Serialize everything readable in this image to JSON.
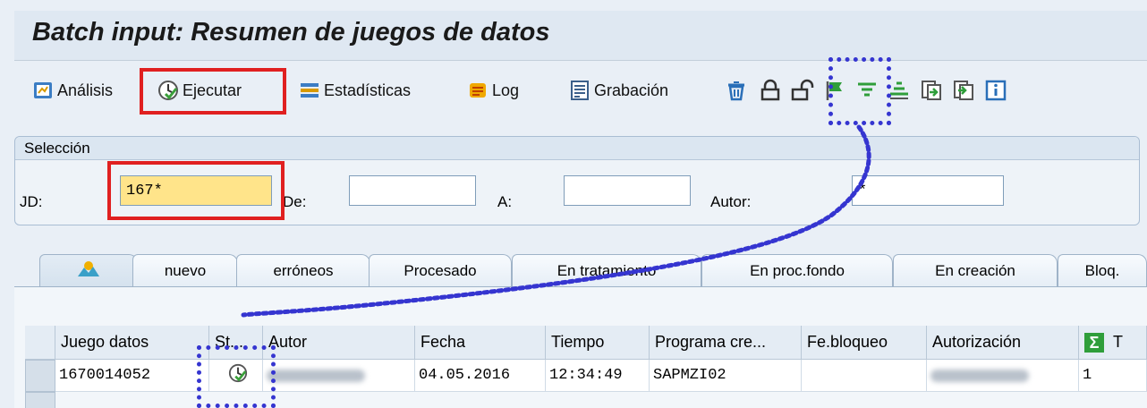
{
  "title": "Batch input: Resumen de juegos de datos",
  "toolbar": {
    "analisis": "Análisis",
    "ejecutar": "Ejecutar",
    "estadisticas": "Estadísticas",
    "log": "Log",
    "grabacion": "Grabación",
    "icons": [
      "delete-icon",
      "lock-icon",
      "unlock-icon",
      "flag-icon",
      "filter-icon",
      "sort-icon",
      "import-icon",
      "export-icon",
      "info-icon"
    ]
  },
  "seleccion": {
    "header": "Selección",
    "jd_label": "JD:",
    "jd_value": "167*",
    "de_label": "De:",
    "de_value": "",
    "a_label": "A:",
    "a_value": "",
    "autor_label": "Autor:",
    "autor_value": "*"
  },
  "tabs": [
    "",
    "nuevo",
    "erróneos",
    "Procesado",
    "En tratamiento",
    "En proc.fondo",
    "En creación",
    "Bloq."
  ],
  "grid": {
    "headers": [
      "Juego datos",
      "St...",
      "Autor",
      "Fecha",
      "Tiempo",
      "Programa cre...",
      "Fe.bloqueo",
      "Autorización",
      "Σ",
      "T"
    ],
    "rows": [
      {
        "juego": "1670014052",
        "status": "execute-icon",
        "autor": "",
        "fecha": "04.05.2016",
        "tiempo": "12:34:49",
        "programa": "SAPMZI02",
        "bloqueo": "",
        "autorizacion": "",
        "count": "1"
      }
    ]
  },
  "colors": {
    "highlight_red": "#e02020",
    "dotted_blue": "#3535d0",
    "input_yellow": "#ffe48a"
  }
}
